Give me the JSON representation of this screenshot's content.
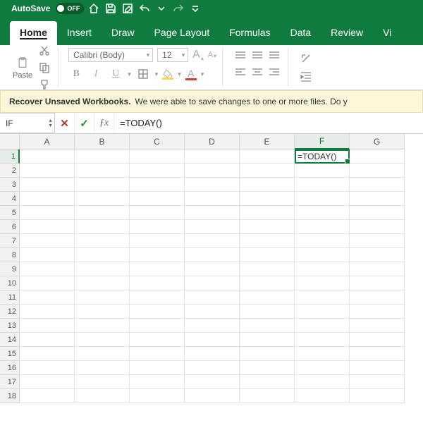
{
  "title": {
    "autosave_label": "AutoSave",
    "autosave_state": "OFF"
  },
  "tabs": [
    "Home",
    "Insert",
    "Draw",
    "Page Layout",
    "Formulas",
    "Data",
    "Review",
    "Vi"
  ],
  "active_tab": 0,
  "ribbon": {
    "paste_label": "Paste",
    "font_name": "Calibri (Body)",
    "font_size": "12",
    "bold": "B",
    "italic": "I",
    "underline": "U",
    "inc_font": "A",
    "dec_font": "A",
    "font_color_letter": "A"
  },
  "recover": {
    "bold": "Recover Unsaved Workbooks.",
    "text": "We were able to save changes to one or more files. Do y"
  },
  "formula_bar": {
    "name_box": "IF",
    "cancel": "✕",
    "confirm": "✓",
    "fx": "ƒx",
    "formula": "=TODAY()"
  },
  "grid": {
    "columns": [
      "A",
      "B",
      "C",
      "D",
      "E",
      "F",
      "G"
    ],
    "rows": 18,
    "selected_col": "F",
    "selected_row": 1,
    "active_cell": {
      "col": "F",
      "row": 1,
      "value": "=TODAY()"
    }
  }
}
